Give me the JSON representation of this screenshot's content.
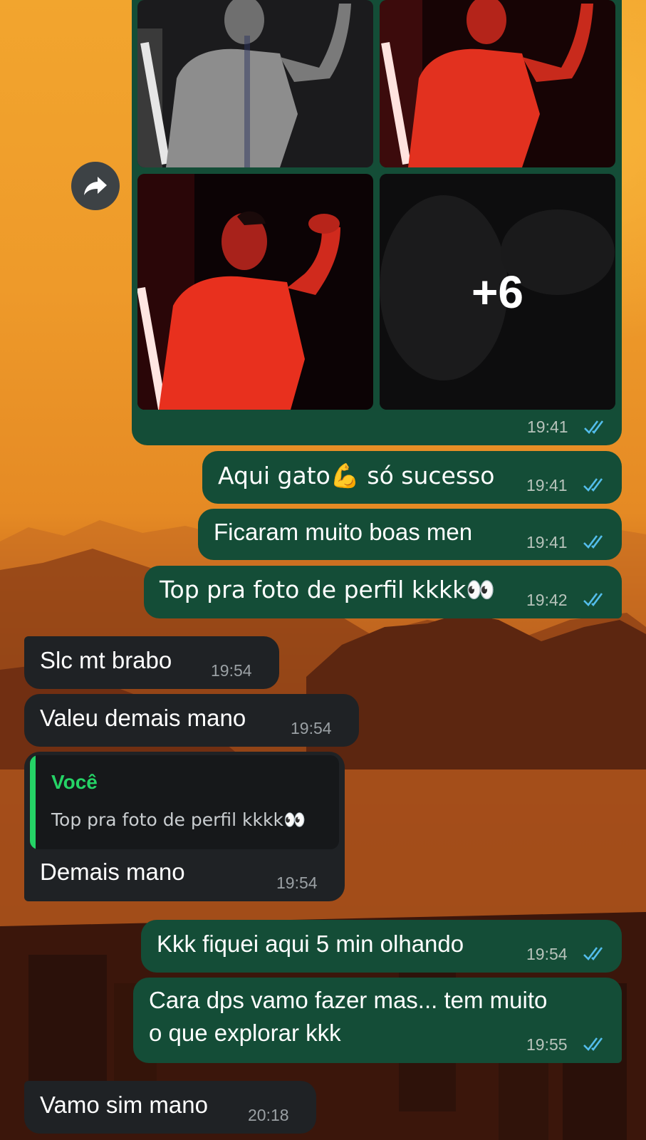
{
  "album": {
    "more_count": "+6",
    "time": "19:41"
  },
  "messages": [
    {
      "id": "m1",
      "direction": "out",
      "text": "Aqui gato💪 só sucesso",
      "time": "19:41",
      "read": true
    },
    {
      "id": "m2",
      "direction": "out",
      "text": "Ficaram muito boas men",
      "time": "19:41",
      "read": true
    },
    {
      "id": "m3",
      "direction": "out",
      "text": "Top pra foto de perfil kkkk👀",
      "time": "19:42",
      "read": true
    },
    {
      "id": "m4",
      "direction": "in",
      "text": "Slc mt brabo",
      "time": "19:54"
    },
    {
      "id": "m5",
      "direction": "in",
      "text": "Valeu demais mano",
      "time": "19:54"
    },
    {
      "id": "m6",
      "direction": "in",
      "text": "Demais mano",
      "time": "19:54",
      "quote": {
        "author": "Você",
        "text": "Top pra foto de perfil kkkk👀"
      }
    },
    {
      "id": "m7",
      "direction": "out",
      "text": "Kkk fiquei aqui 5 min olhando",
      "time": "19:54",
      "read": true
    },
    {
      "id": "m8",
      "direction": "out",
      "lines": [
        "Cara dps vamo fazer mas... tem muito",
        "o que explorar kkk"
      ],
      "time": "19:55",
      "read": true
    },
    {
      "id": "m9",
      "direction": "in",
      "text": "Vamo sim mano",
      "time": "20:18"
    }
  ],
  "icons": {
    "forward": "forward-arrow-icon",
    "read_receipt": "double-check-icon"
  },
  "colors": {
    "outgoing_bubble": "#144d37",
    "incoming_bubble": "#1f2225",
    "read_ticks": "#53bdeb",
    "quote_accent": "#25d366"
  }
}
